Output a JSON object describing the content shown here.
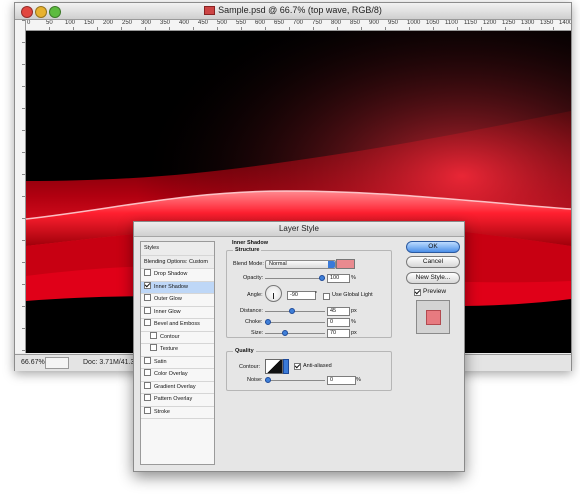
{
  "window": {
    "title": "Sample.psd @ 66.7% (top wave, RGB/8)"
  },
  "ruler": {
    "ticks": [
      "0",
      "50",
      "100",
      "150",
      "200",
      "250",
      "300",
      "350",
      "400",
      "450",
      "500",
      "550",
      "600",
      "650",
      "700",
      "750",
      "800",
      "850",
      "900",
      "950",
      "1000",
      "1050",
      "1100",
      "1150",
      "1200",
      "1250",
      "1300",
      "1350",
      "1400"
    ]
  },
  "status": {
    "zoom": "66.67%",
    "doc": "Doc: 3.71M/41.3M"
  },
  "dialog": {
    "title": "Layer Style",
    "styles": [
      {
        "label": "Styles",
        "type": "header"
      },
      {
        "label": "Blending Options: Custom",
        "type": "header"
      },
      {
        "label": "Drop Shadow",
        "checked": false
      },
      {
        "label": "Inner Shadow",
        "checked": true,
        "selected": true
      },
      {
        "label": "Outer Glow",
        "checked": false
      },
      {
        "label": "Inner Glow",
        "checked": false
      },
      {
        "label": "Bevel and Emboss",
        "checked": false
      },
      {
        "label": "Contour",
        "checked": false,
        "sub": true
      },
      {
        "label": "Texture",
        "checked": false,
        "sub": true
      },
      {
        "label": "Satin",
        "checked": false
      },
      {
        "label": "Color Overlay",
        "checked": false
      },
      {
        "label": "Gradient Overlay",
        "checked": false
      },
      {
        "label": "Pattern Overlay",
        "checked": false
      },
      {
        "label": "Stroke",
        "checked": false
      }
    ],
    "panel_title": "Inner Shadow",
    "structure": {
      "title": "Structure",
      "blend_mode_label": "Blend Mode:",
      "blend_mode_value": "Normal",
      "swatch_color": "#e98a8f",
      "opacity_label": "Opacity:",
      "opacity_value": "100",
      "opacity_unit": "%",
      "opacity_level": 1.0,
      "angle_label": "Angle:",
      "angle_value": "-90",
      "angle_unit": "°",
      "global_light_label": "Use Global Light",
      "distance_label": "Distance:",
      "distance_value": "45",
      "distance_unit": "px",
      "distance_level": 0.45,
      "choke_label": "Choke:",
      "choke_value": "0",
      "choke_unit": "%",
      "choke_level": 0.0,
      "size_label": "Size:",
      "size_value": "70",
      "size_unit": "px",
      "size_level": 0.32
    },
    "quality": {
      "title": "Quality",
      "contour_label": "Contour:",
      "anti_aliased_label": "Anti-aliased",
      "noise_label": "Noise:",
      "noise_value": "0",
      "noise_unit": "%",
      "noise_level": 0.0
    },
    "buttons": {
      "ok": "OK",
      "cancel": "Cancel",
      "new_style": "New Style...",
      "preview": "Preview"
    },
    "preview_color": "#e77a80"
  }
}
